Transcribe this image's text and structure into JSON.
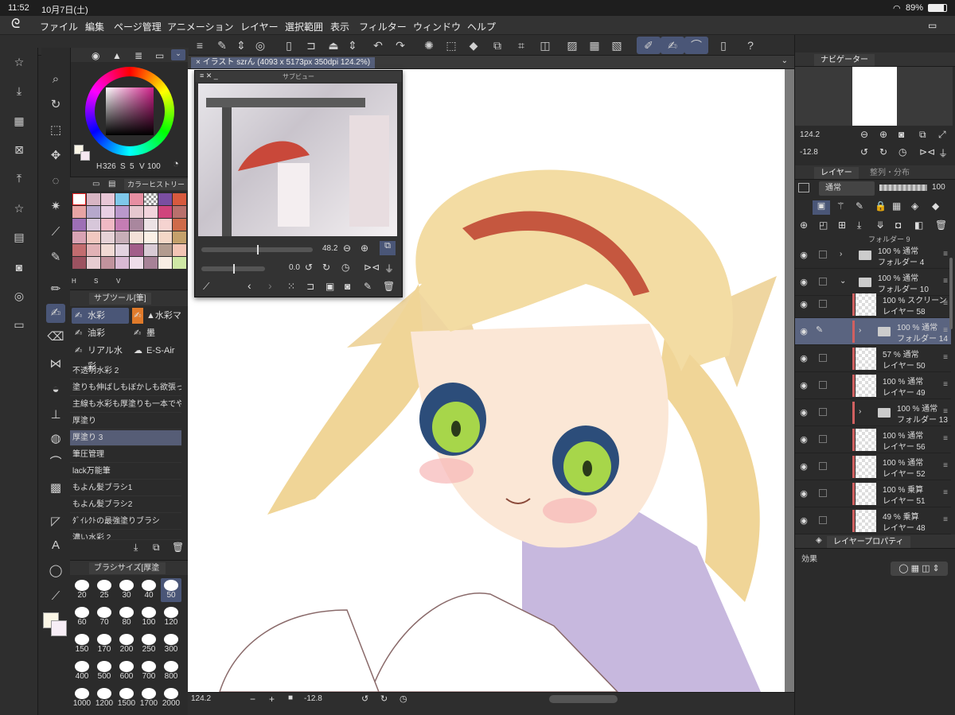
{
  "status": {
    "time": "11:52",
    "date": "10月7日(土)",
    "battery": "89%"
  },
  "menu": [
    "ファイル",
    "編集",
    "ページ管理",
    "アニメーション",
    "レイヤー",
    "選択範囲",
    "表示",
    "フィルター",
    "ウィンドウ",
    "ヘルプ"
  ],
  "document": {
    "tab_title": "イラスト szrん (4093 x 5173px 350dpi 124.2%)"
  },
  "subview": {
    "title": "サブビュー",
    "zoom": "48.2",
    "angle": "0.0"
  },
  "color": {
    "h_label": "H",
    "h": "326",
    "s_label": "S",
    "s": "5",
    "v_label": "V",
    "v": "100",
    "accent": "#4a5677"
  },
  "history": {
    "title": "カラーヒストリー",
    "labels": [
      "H",
      "S",
      "V"
    ]
  },
  "subtool": {
    "title": "サブツール[筆]",
    "groups": [
      "水彩",
      "▲水彩マー",
      "油彩",
      "墨",
      "リアル水彩",
      "E-S-Air"
    ],
    "brushes": [
      "不透明水彩 2",
      "塗りも伸ばしもぼかしも欲張ったペン",
      "主線も水彩も厚塗りも一本でやる",
      "厚塗り",
      "厚塗り 3",
      "筆圧管理",
      "lack万能筆",
      "もよん髪ブラシ1",
      "もよん髪ブラシ2",
      "ﾀﾞｲﾚｸﾄの最強塗りブラシ",
      "濃い水彩 2"
    ],
    "selected_brush": "厚塗り 3"
  },
  "brushsize": {
    "title": "ブラシサイズ[厚塗",
    "sizes": [
      "20",
      "25",
      "30",
      "40",
      "50",
      "60",
      "70",
      "80",
      "100",
      "120",
      "150",
      "170",
      "200",
      "250",
      "300",
      "400",
      "500",
      "600",
      "700",
      "800",
      "1000",
      "1200",
      "1500",
      "1700",
      "2000"
    ],
    "selected": "50"
  },
  "navigator": {
    "title": "ナビゲーター",
    "zoom": "124.2",
    "angle": "-12.8"
  },
  "layers": {
    "title": "レイヤー",
    "tab2": "整列・分布",
    "blend": "通常",
    "opacity": "100",
    "top_item": "フォルダー 9",
    "rows": [
      {
        "line1": "100 % 通常",
        "line2": "フォルダー 4",
        "type": "folder"
      },
      {
        "line1": "100 % 通常",
        "line2": "フォルダー 10",
        "type": "folder-open"
      },
      {
        "line1": "100 % スクリーン",
        "line2": "レイヤー 58",
        "type": "layer"
      },
      {
        "line1": "100 % 通常",
        "line2": "フォルダー 14",
        "type": "folder",
        "selected": true
      },
      {
        "line1": "57 % 通常",
        "line2": "レイヤー 50",
        "type": "layer"
      },
      {
        "line1": "100 % 通常",
        "line2": "レイヤー 49",
        "type": "layer"
      },
      {
        "line1": "100 % 通常",
        "line2": "フォルダー 13",
        "type": "folder"
      },
      {
        "line1": "100 % 通常",
        "line2": "レイヤー 56",
        "type": "layer"
      },
      {
        "line1": "100 % 通常",
        "line2": "レイヤー 52",
        "type": "layer"
      },
      {
        "line1": "100 % 乗算",
        "line2": "レイヤー 51",
        "type": "layer"
      },
      {
        "line1": "49 % 乗算",
        "line2": "レイヤー 48",
        "type": "layer"
      }
    ]
  },
  "layerprops": {
    "title": "レイヤープロパティ",
    "effect": "効果"
  },
  "bottom": {
    "zoom": "124.2",
    "angle": "-12.8"
  }
}
